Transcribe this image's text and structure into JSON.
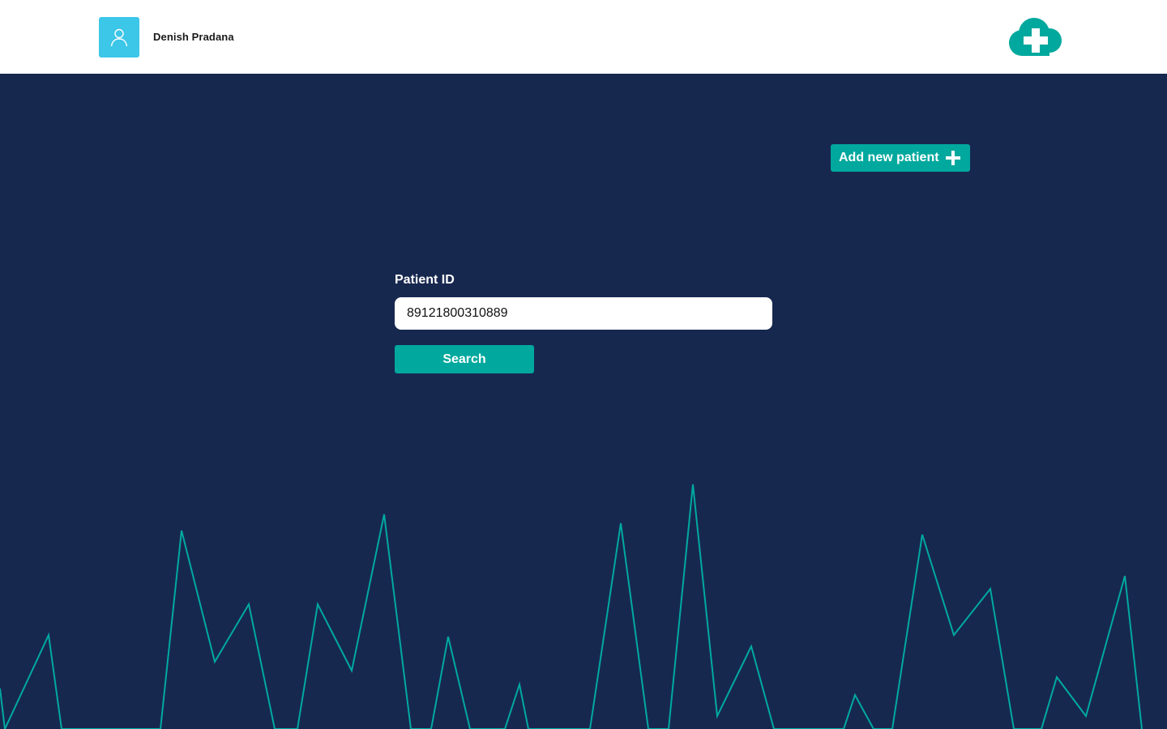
{
  "header": {
    "user_name": "Denish Pradana",
    "avatar_icon": "user-icon",
    "logo_icon": "cloud-plus-icon"
  },
  "actions": {
    "add_patient_label": "Add new patient",
    "add_patient_icon": "plus-icon"
  },
  "search": {
    "label": "Patient ID",
    "value": "89121800310889",
    "button_label": "Search"
  },
  "colors": {
    "background": "#17284F",
    "header_bg": "#FFFFFF",
    "accent": "#00A89D",
    "avatar_bg": "#3CC6E8",
    "pulse_line": "#00A9A0"
  }
}
